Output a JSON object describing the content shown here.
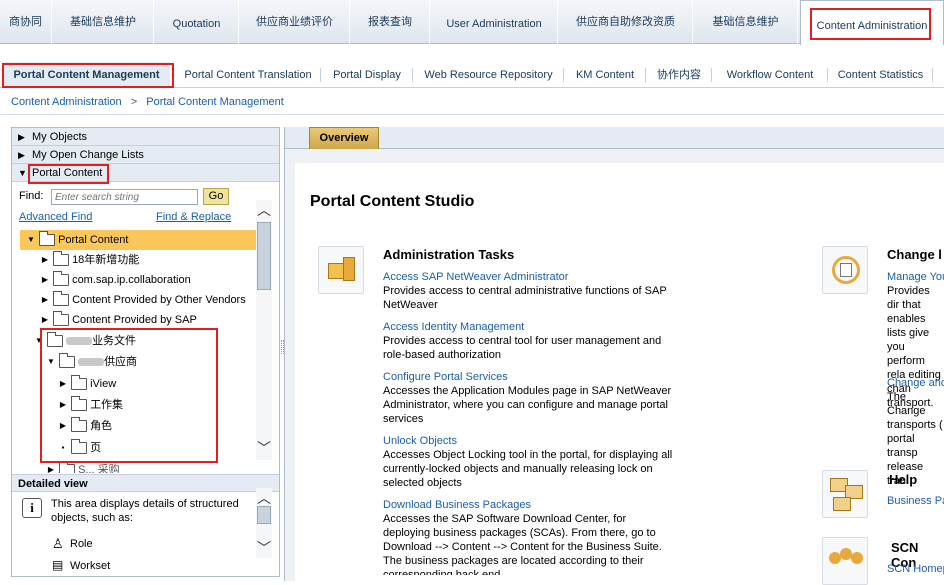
{
  "top_tabs": [
    "商协同",
    "基础信息维护",
    "Quotation",
    "供应商业绩评价",
    "报表查询",
    "User Administration",
    "供应商自助修改资质",
    "基础信息维护",
    "Content Administration"
  ],
  "sub_tabs": [
    "Portal Content Management",
    "Portal Content Translation",
    "Portal Display",
    "Web Resource Repository",
    "KM Content",
    "协作内容",
    "Workflow Content",
    "Content Statistics"
  ],
  "breadcrumb": [
    "Content Administration",
    ">",
    "Portal Content Management"
  ],
  "left": {
    "sections": [
      "My Objects",
      "My Open Change Lists",
      "Portal Content"
    ],
    "find_label": "Find:",
    "search_placeholder": "Enter search string",
    "go_label": "Go",
    "advanced_find": "Advanced Find",
    "find_replace": "Find & Replace",
    "tree": [
      {
        "label": "Portal Content",
        "expander": "▼"
      },
      {
        "label": "18年新增功能",
        "expander": "▶"
      },
      {
        "label": "com.sap.ip.collaboration",
        "expander": "▶"
      },
      {
        "label": "Content Provided by Other Vendors",
        "expander": "▶"
      },
      {
        "label": "Content Provided by SAP",
        "expander": "▶"
      },
      {
        "label": "业务文件",
        "expander": "▼"
      },
      {
        "label": "供应商",
        "expander": "▼"
      },
      {
        "label": "iView",
        "expander": "▶"
      },
      {
        "label": "工作集",
        "expander": "▶"
      },
      {
        "label": "角色",
        "expander": "▶"
      },
      {
        "label": "页",
        "expander": "▪"
      },
      {
        "label": "S... 采购",
        "expander": "▶"
      }
    ],
    "detailed_view_title": "Detailed view",
    "detailed_text": "This area displays details of structured objects, such as:",
    "detail_items": [
      "Role",
      "Workset"
    ]
  },
  "right": {
    "tab": "Overview",
    "title": "Portal Content Studio",
    "admin_title": "Administration Tasks",
    "admin_items": [
      {
        "link": "Access SAP NetWeaver Administrator",
        "desc": "Provides access to central administrative functions of SAP NetWeaver"
      },
      {
        "link": "Access Identity Management",
        "desc": "Provides access to central tool for user management and role-based authorization"
      },
      {
        "link": "Configure Portal Services",
        "desc": "Accesses the Application Modules page in SAP NetWeaver Administrator, where you can configure and manage portal services"
      },
      {
        "link": "Unlock Objects",
        "desc": "Accesses Object Locking tool in the portal, for displaying all currently-locked objects and manually releasing lock on selected objects"
      },
      {
        "link": "Download Business Packages",
        "desc": "Accesses the SAP Software Download Center, for deploying business packages (SCAs). From there, go to Download --> Content --> Content for the Business Suite. The business packages are located according to their corresponding back end."
      }
    ],
    "change_title": "Change l",
    "change_link1": "Manage You",
    "change_desc1": "Provides dir that enables lists give you perform rela editing chan transport.",
    "change_link2": "Change and",
    "change_desc2": "The Change transports ( portal transp release tran",
    "help_title": "Help",
    "help_link": "Business Pa",
    "scn_title": "SCN Con",
    "scn_link": "SCN Homep"
  }
}
